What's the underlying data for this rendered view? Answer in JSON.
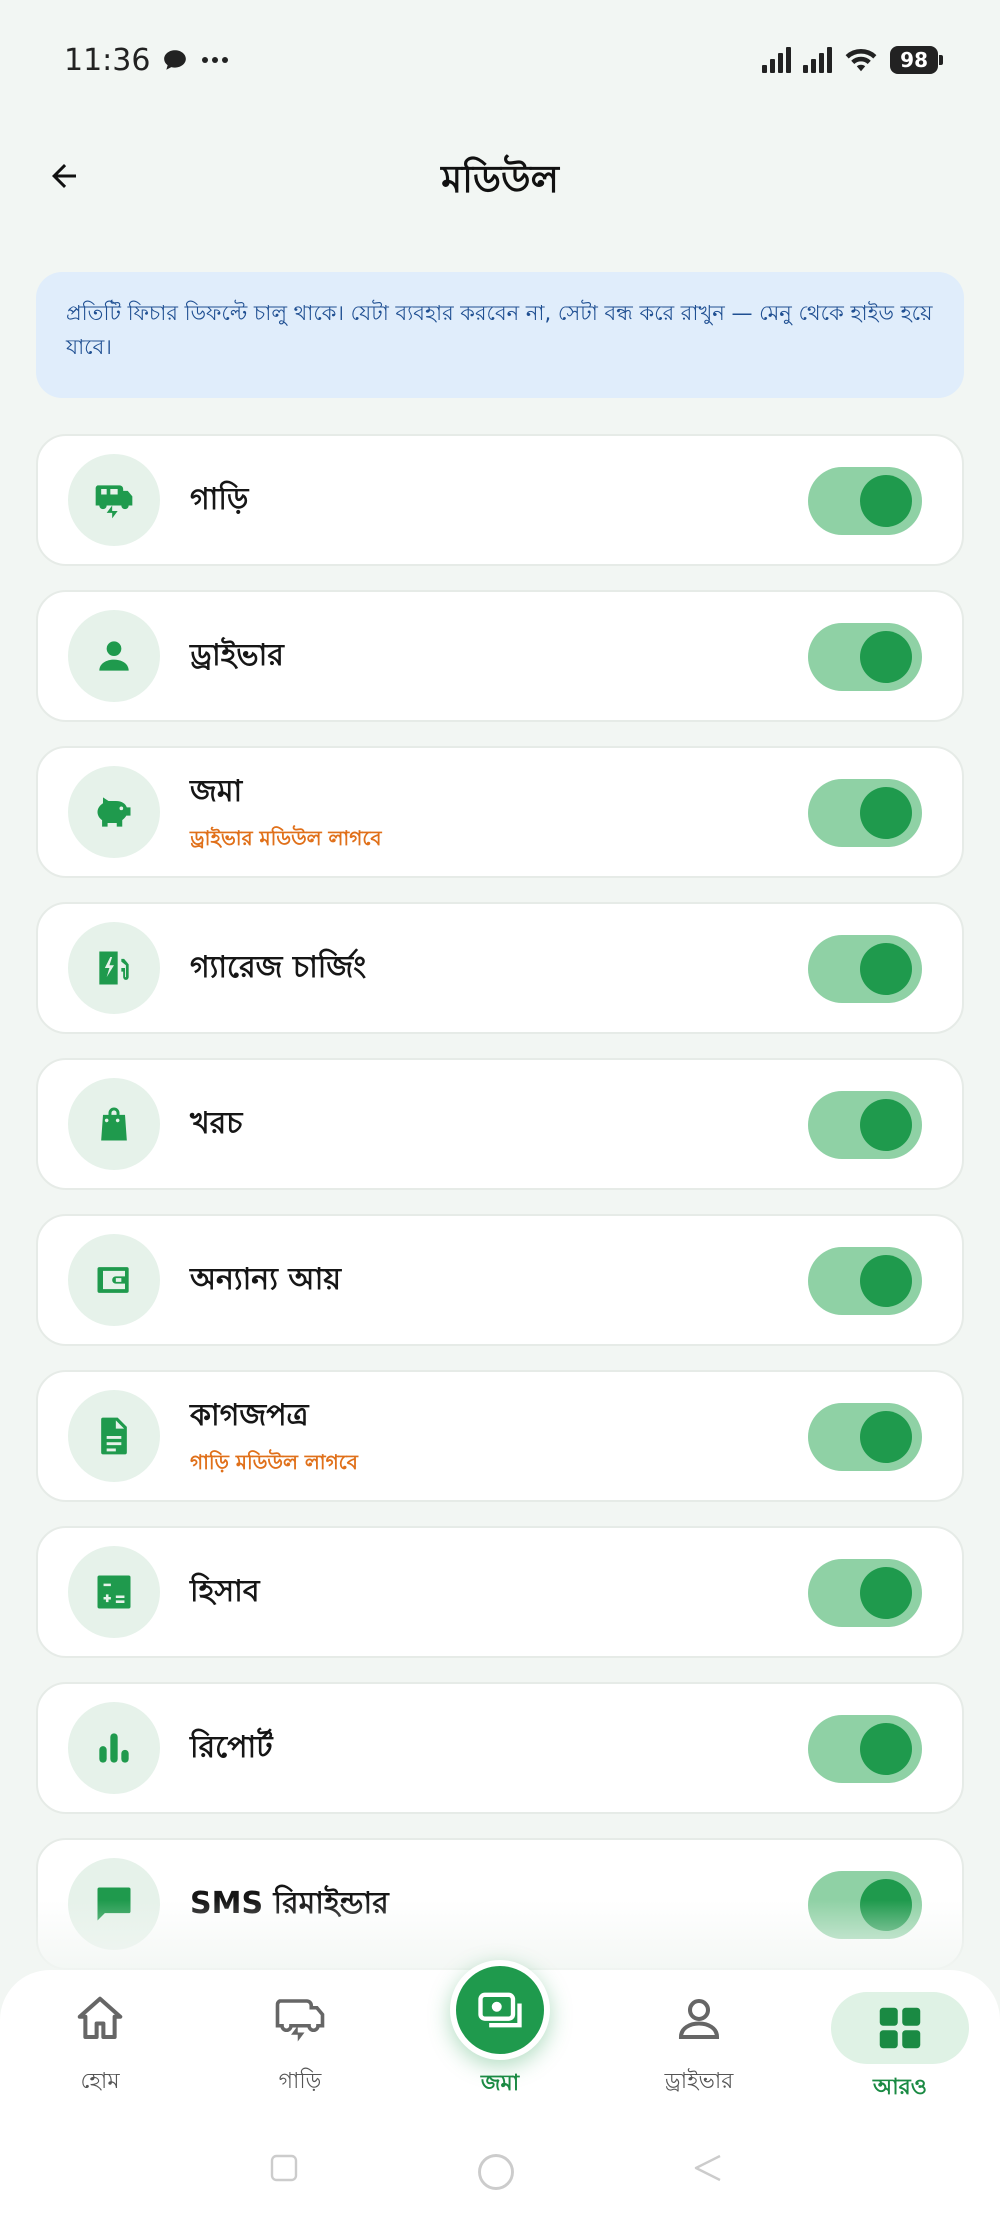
{
  "status_bar": {
    "time": "11:36",
    "battery": "98"
  },
  "header": {
    "title": "মডিউল"
  },
  "info": {
    "text": "প্রতিটি ফিচার ডিফল্টে চালু থাকে। যেটা ব্যবহার করবেন না, সেটা বন্ধ করে রাখুন — মেনু থেকে হাইড হয়ে যাবে।"
  },
  "modules": [
    {
      "label": "গাড়ি",
      "sub": "",
      "icon": "car-transfer-icon",
      "enabled": true
    },
    {
      "label": "ড্রাইভার",
      "sub": "",
      "icon": "person-icon",
      "enabled": true
    },
    {
      "label": "জমা",
      "sub": "ড্রাইভার মডিউল লাগবে",
      "icon": "piggy-bank-icon",
      "enabled": true
    },
    {
      "label": "গ্যারেজ চার্জিং",
      "sub": "",
      "icon": "ev-charging-icon",
      "enabled": true
    },
    {
      "label": "খরচ",
      "sub": "",
      "icon": "shopping-bag-icon",
      "enabled": true
    },
    {
      "label": "অন্যান্য আয়",
      "sub": "",
      "icon": "wallet-icon",
      "enabled": true
    },
    {
      "label": "কাগজপত্র",
      "sub": "গাড়ি মডিউল লাগবে",
      "icon": "document-icon",
      "enabled": true
    },
    {
      "label": "হিসাব",
      "sub": "",
      "icon": "calculator-icon",
      "enabled": true
    },
    {
      "label": "রিপোর্ট",
      "sub": "",
      "icon": "bar-chart-icon",
      "enabled": true
    },
    {
      "label": "SMS রিমাইন্ডার",
      "sub": "",
      "icon": "message-icon",
      "enabled": true
    }
  ],
  "bottom_nav": {
    "home": "হোম",
    "cars": "গাড়ি",
    "deposit": "জমা",
    "drivers": "ড্রাইভার",
    "more": "আরও"
  },
  "colors": {
    "accent": "#1f9a4d",
    "toggle_track": "#8fd1a5",
    "info_bg": "#e0edfb",
    "info_text": "#1f4f92",
    "warning_text": "#e0701a"
  }
}
